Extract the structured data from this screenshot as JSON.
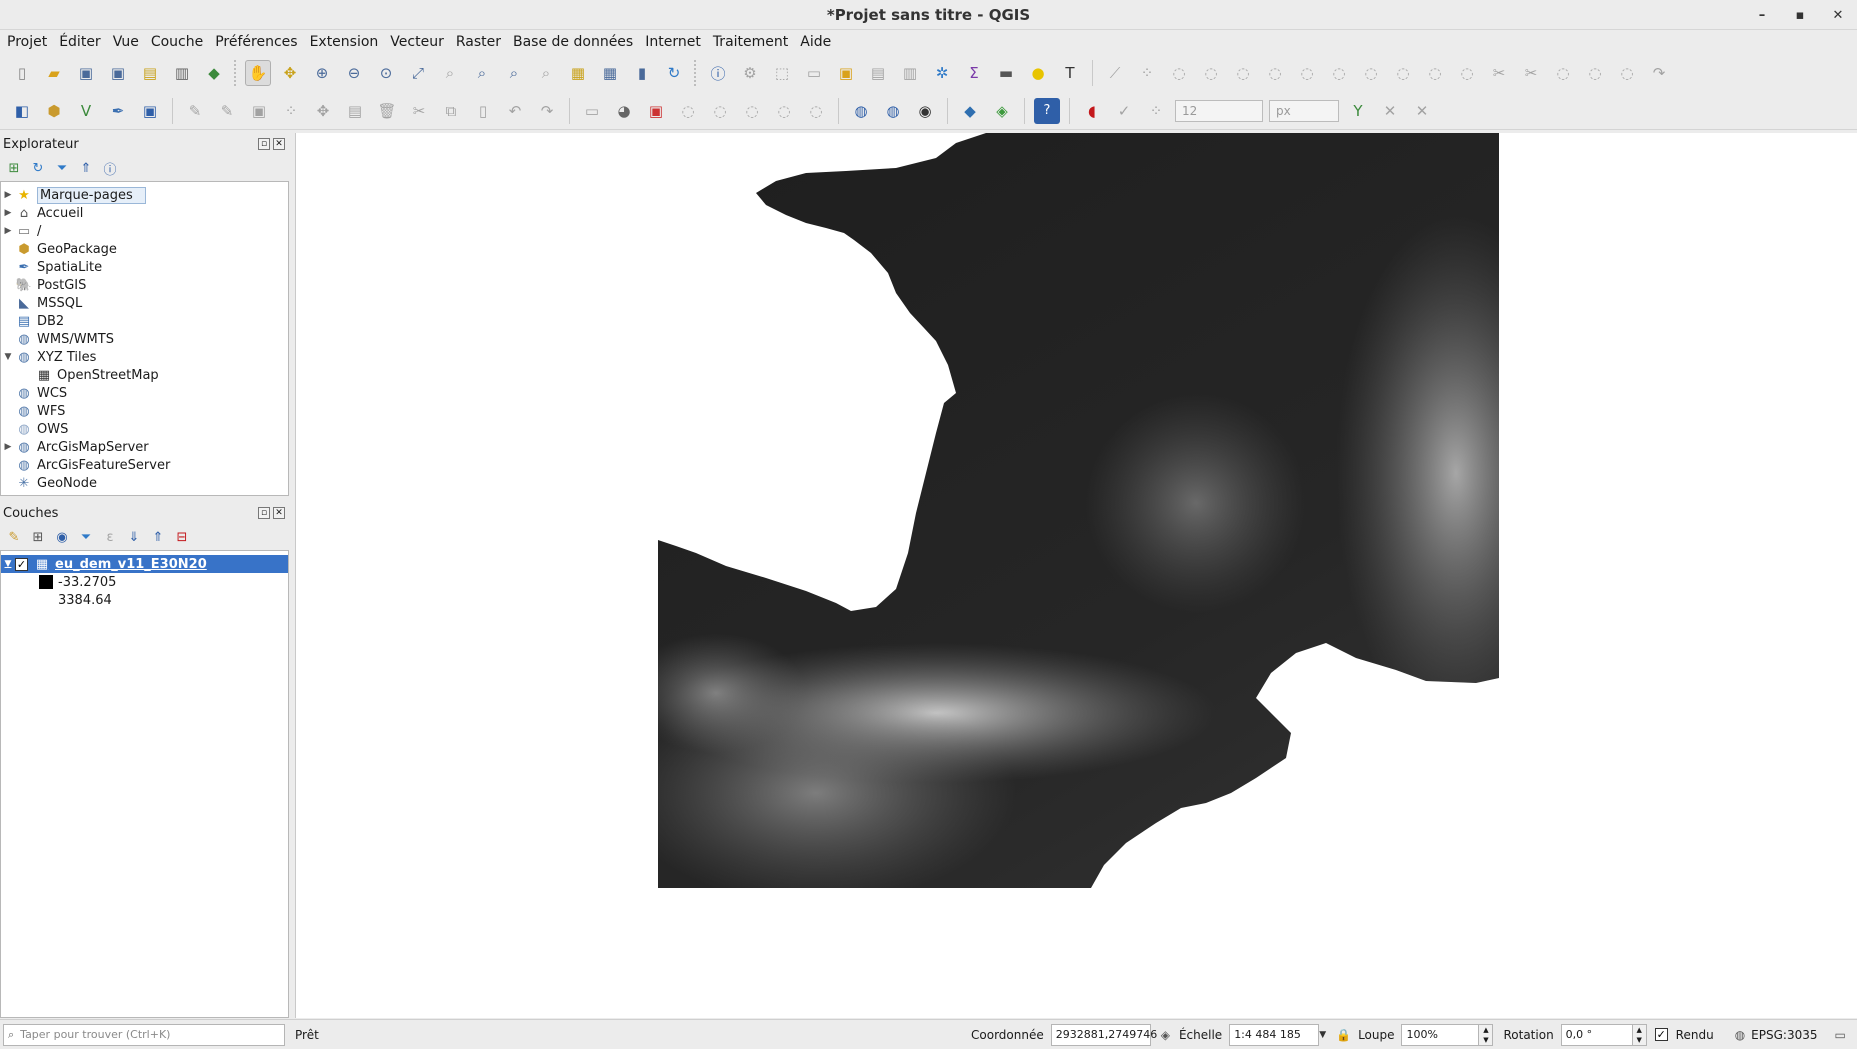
{
  "window": {
    "title": "*Projet sans titre - QGIS",
    "minimize": "–",
    "maximize": "▪",
    "close": "✕"
  },
  "menu": [
    "Projet",
    "Éditer",
    "Vue",
    "Couche",
    "Préférences",
    "Extension",
    "Vecteur",
    "Raster",
    "Base de données",
    "Internet",
    "Traitement",
    "Aide"
  ],
  "toolbar2": {
    "font_size_value": "12",
    "unit_value": "px"
  },
  "explorer": {
    "title": "Explorateur",
    "items": [
      {
        "label": "Marque-pages",
        "icon": "star-icon",
        "glyph": "★",
        "color": "#e8b400",
        "expand": "▶",
        "selected": true
      },
      {
        "label": "Accueil",
        "icon": "home-icon",
        "glyph": "⌂",
        "color": "#555",
        "expand": "▶"
      },
      {
        "label": "/",
        "icon": "folder-icon",
        "glyph": "▭",
        "color": "#777",
        "expand": "▶"
      },
      {
        "label": "GeoPackage",
        "icon": "geopackage-icon",
        "glyph": "⬢",
        "color": "#c99a2e",
        "expand": ""
      },
      {
        "label": "SpatiaLite",
        "icon": "spatialite-icon",
        "glyph": "✒",
        "color": "#3b6fb0",
        "expand": ""
      },
      {
        "label": "PostGIS",
        "icon": "postgis-icon",
        "glyph": "🐘",
        "color": "#36638f",
        "expand": ""
      },
      {
        "label": "MSSQL",
        "icon": "mssql-icon",
        "glyph": "◣",
        "color": "#4a6a9a",
        "expand": ""
      },
      {
        "label": "DB2",
        "icon": "db2-icon",
        "glyph": "▤",
        "color": "#3b6fb0",
        "expand": ""
      },
      {
        "label": "WMS/WMTS",
        "icon": "wms-globe-icon",
        "glyph": "◍",
        "color": "#4b73a6",
        "expand": ""
      },
      {
        "label": "XYZ Tiles",
        "icon": "xyz-globe-icon",
        "glyph": "◍",
        "color": "#4b73a6",
        "expand": "▼"
      },
      {
        "label": "OpenStreetMap",
        "icon": "osm-tiles-icon",
        "glyph": "▦",
        "color": "#333",
        "expand": "",
        "indent": true
      },
      {
        "label": "WCS",
        "icon": "wcs-globe-icon",
        "glyph": "◍",
        "color": "#4b73a6",
        "expand": ""
      },
      {
        "label": "WFS",
        "icon": "wfs-globe-icon",
        "glyph": "◍",
        "color": "#4b73a6",
        "expand": ""
      },
      {
        "label": "OWS",
        "icon": "ows-globe-icon",
        "glyph": "◍",
        "color": "#8aa3c4",
        "expand": ""
      },
      {
        "label": "ArcGisMapServer",
        "icon": "arcgis-map-icon",
        "glyph": "◍",
        "color": "#4b73a6",
        "expand": "▶"
      },
      {
        "label": "ArcGisFeatureServer",
        "icon": "arcgis-feature-icon",
        "glyph": "◍",
        "color": "#4b73a6",
        "expand": ""
      },
      {
        "label": "GeoNode",
        "icon": "geonode-icon",
        "glyph": "✳",
        "color": "#4b73a6",
        "expand": ""
      }
    ]
  },
  "layers": {
    "title": "Couches",
    "layer_name": "eu_dem_v11_E30N20",
    "expand": "▼",
    "check": "✓",
    "legend_min": "-33.2705",
    "legend_max": "3384.64"
  },
  "status": {
    "search_placeholder": "Taper pour trouver (Ctrl+K)",
    "ready": "Prêt",
    "coord_label": "Coordonnée",
    "coord_value": "2932881,2749746",
    "scale_label": "Échelle",
    "scale_value": "1:4 484 185",
    "loupe_label": "Loupe",
    "loupe_value": "100%",
    "rotation_label": "Rotation",
    "rotation_value": "0,0 °",
    "render_label": "Rendu",
    "crs": "EPSG:3035"
  },
  "colors": {
    "selection": "#3873c8",
    "accent": "#e8b400"
  }
}
